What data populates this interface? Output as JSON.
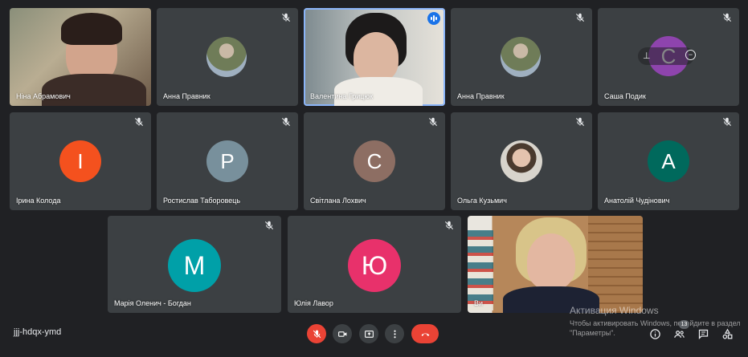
{
  "meeting": {
    "code": "jjj-hdqx-ymd",
    "participants_count": "13"
  },
  "tiles": [
    {
      "name": "Ніна Абрамович"
    },
    {
      "name": "Анна Правник"
    },
    {
      "name": "Валентина Грицюк"
    },
    {
      "name": "Анна Правник"
    },
    {
      "name": "Саша Подик",
      "initial": "С"
    },
    {
      "name": "Ірина Колода",
      "initial": "І"
    },
    {
      "name": "Ростислав Таборовець",
      "initial": "Р"
    },
    {
      "name": "Світлана Лохвич",
      "initial": "С"
    },
    {
      "name": "Ольга Кузьмич"
    },
    {
      "name": "Анатолій Чудінович",
      "initial": "А"
    },
    {
      "name": "Марія Оленич - Богдан",
      "initial": "М"
    },
    {
      "name": "Юлія Лавор",
      "initial": "Ю"
    },
    {
      "name": "Ви"
    }
  ],
  "watermark": {
    "line1": "Активация Windows",
    "line2": "Чтобы активировать Windows, перейдите в раздел",
    "line3": "\"Параметры\"."
  },
  "colors": {
    "background": "#202124",
    "tile": "#3c4043",
    "end_call": "#ea4335",
    "avatar_orange": "#f4511e",
    "avatar_slate": "#78909c",
    "avatar_brown": "#8d6e63",
    "avatar_green": "#00695c",
    "avatar_teal": "#00a0a8",
    "avatar_pink": "#e8316b",
    "avatar_purple": "#8e44ad"
  }
}
